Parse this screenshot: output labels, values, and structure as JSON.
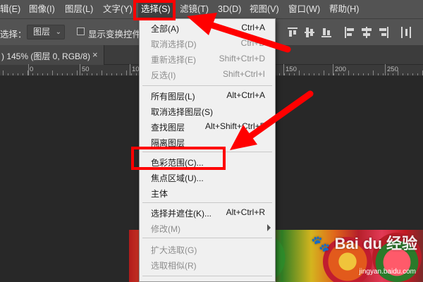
{
  "menubar": {
    "items": [
      {
        "label": "辑(E)"
      },
      {
        "label": "图像(I)"
      },
      {
        "label": "图层(L)"
      },
      {
        "label": "文字(Y)"
      },
      {
        "label": "选择(S)"
      },
      {
        "label": "滤镜(T)"
      },
      {
        "label": "3D(D)"
      },
      {
        "label": "视图(V)"
      },
      {
        "label": "窗口(W)"
      },
      {
        "label": "帮助(H)"
      }
    ],
    "active_index": 4
  },
  "options": {
    "select_label": "选择：",
    "select_value": "图层",
    "show_transform_label": "显示变换控件"
  },
  "tab": {
    "title": ") 145% (图层 0, RGB/8)",
    "close": "×"
  },
  "ruler": {
    "labels": [
      "0",
      "50",
      "100",
      "150",
      "200",
      "250"
    ]
  },
  "menu": {
    "items": [
      {
        "label": "全部(A)",
        "shortcut": "Ctrl+A",
        "enabled": true
      },
      {
        "label": "取消选择(D)",
        "shortcut": "Ctrl+D",
        "enabled": false
      },
      {
        "label": "重新选择(E)",
        "shortcut": "Shift+Ctrl+D",
        "enabled": false
      },
      {
        "label": "反选(I)",
        "shortcut": "Shift+Ctrl+I",
        "enabled": false
      },
      {
        "label": "所有图层(L)",
        "shortcut": "Alt+Ctrl+A",
        "enabled": true
      },
      {
        "label": "取消选择图层(S)",
        "shortcut": "",
        "enabled": true
      },
      {
        "label": "查找图层",
        "shortcut": "Alt+Shift+Ctrl+F",
        "enabled": true
      },
      {
        "label": "隔离图层",
        "shortcut": "",
        "enabled": true
      },
      {
        "label": "色彩范围(C)...",
        "shortcut": "",
        "enabled": true
      },
      {
        "label": "焦点区域(U)...",
        "shortcut": "",
        "enabled": true
      },
      {
        "label": "主体",
        "shortcut": "",
        "enabled": true
      },
      {
        "label": "选择并遮住(K)...",
        "shortcut": "Alt+Ctrl+R",
        "enabled": true
      },
      {
        "label": "修改(M)",
        "shortcut": "",
        "enabled": false
      },
      {
        "label": "扩大选取(G)",
        "shortcut": "",
        "enabled": false
      },
      {
        "label": "选取相似(R)",
        "shortcut": "",
        "enabled": false
      }
    ]
  },
  "watermark": {
    "brand": "Bai du 经验",
    "url": "jingyan.baidu.com"
  },
  "colors": {
    "annotation": "#ff0000",
    "menubar_bg": "#535353",
    "menu_bg": "#f0f0f0"
  }
}
